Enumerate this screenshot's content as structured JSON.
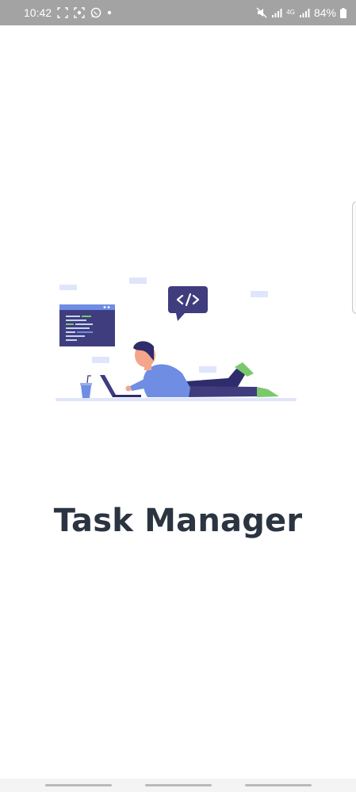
{
  "status_bar": {
    "time": "10:42",
    "battery_percent": "84%",
    "network_label": "4G",
    "left_icons": [
      "screenshot-icon",
      "screen-record-icon",
      "whatsapp-icon",
      "notification-dot-icon"
    ],
    "right_icons": [
      "mute-icon",
      "signal-icon",
      "signal-icon",
      "battery-icon"
    ]
  },
  "splash": {
    "title": "Task Manager"
  },
  "nav_bar": {
    "buttons": [
      "recent-apps",
      "home",
      "back"
    ]
  },
  "colors": {
    "status_bar": "#a3a3a3",
    "title_text": "#2b3441",
    "illustration_primary": "#3f3d7d",
    "illustration_accent": "#6f8de3",
    "illustration_green": "#7bc86c",
    "illustration_light": "#dfe6fb"
  }
}
